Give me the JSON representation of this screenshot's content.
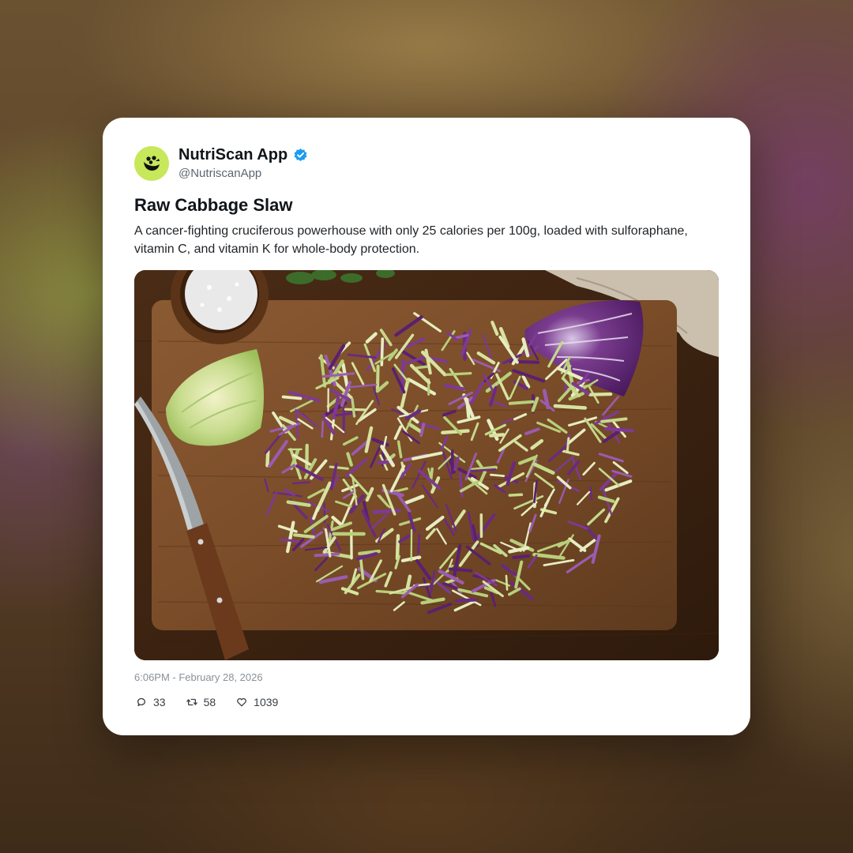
{
  "post": {
    "author_name": "NutriScan App",
    "author_handle": "@NutriscanApp",
    "verified": true,
    "title": "Raw Cabbage Slaw",
    "description": "A cancer-fighting cruciferous powerhouse with only 25 calories per 100g, loaded with sulforaphane, vitamin C, and vitamin K for whole-body protection.",
    "timestamp": "6:06PM - February 28, 2026",
    "stats": {
      "replies": "33",
      "reposts": "58",
      "likes": "1039"
    }
  },
  "colors": {
    "avatar_bg": "#c7e85a",
    "verified_badge": "#1d9bf0",
    "card_bg": "#ffffff"
  },
  "icons": {
    "avatar": "nutriscan-logo-icon",
    "verified": "verified-badge-icon",
    "replies": "comment-icon",
    "reposts": "repost-icon",
    "likes": "heart-icon"
  }
}
